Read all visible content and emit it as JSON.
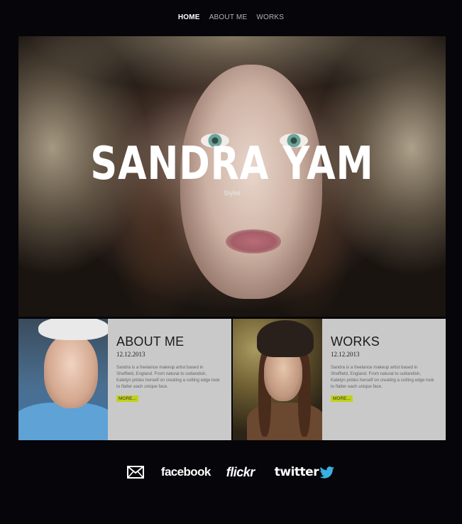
{
  "nav": {
    "items": [
      "HOME",
      "ABOUT ME",
      "WORKS"
    ],
    "active": "HOME"
  },
  "hero": {
    "title": "SANDRA YAM",
    "subtitle": "Stylist"
  },
  "cards": [
    {
      "title": "ABOUT ME",
      "date": "12.12.2013",
      "text": "Sandra is a freelance makeup artist based in Sheffield, England. From natural to outlandish, Katelyn prides herself on creating a cutting edge look to flatter each unique face.",
      "more": "MORE..."
    },
    {
      "title": "WORKS",
      "date": "12.12.2013",
      "text": "Sandra is a freelance makeup artist based in Sheffield, England. From natural to outlandish, Katelyn prides herself on creating a cutting edge look to flatter each unique face.",
      "more": "MORE..."
    }
  ],
  "social": {
    "email_icon": "envelope-icon",
    "facebook": "facebook",
    "flickr": "flickr",
    "twitter": "twitter"
  },
  "colors": {
    "background": "#060509",
    "card_bg": "#c9c9c9",
    "more_highlight": "#c2d21a",
    "twitter_blue": "#3ab0e2"
  }
}
